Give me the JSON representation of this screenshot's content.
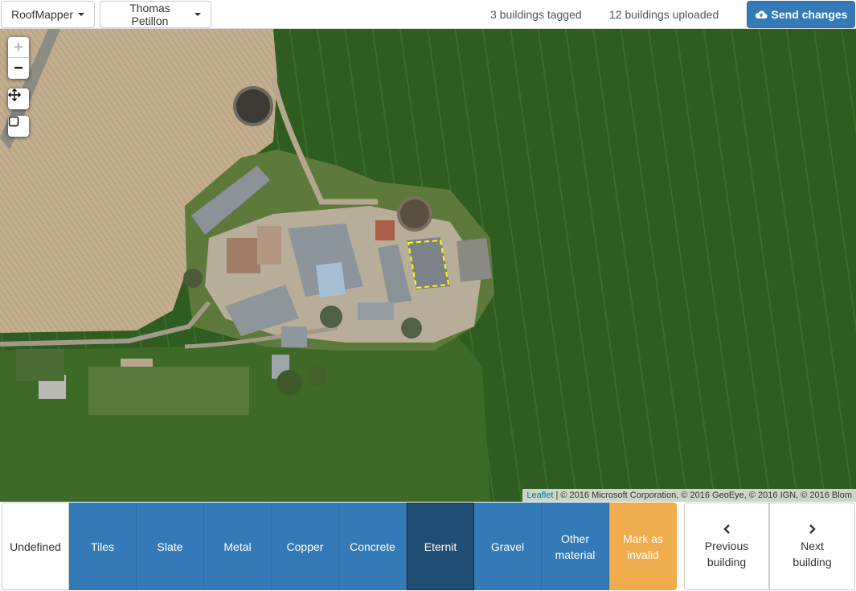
{
  "navbar": {
    "project_menu": "RoofMapper",
    "user_menu": "Thomas Petillon",
    "tagged_count": "3 buildings tagged",
    "uploaded_count": "12 buildings uploaded",
    "send_label": "Send changes"
  },
  "map": {
    "zoom_in": "+",
    "zoom_out": "−",
    "attribution_link": "Leaflet",
    "attribution_text": " | © 2016 Microsoft Corporation, © 2016 GeoEye, © 2016 IGN, © 2016 Blom"
  },
  "materials": {
    "undefined": "Undefined",
    "tiles": "Tiles",
    "slate": "Slate",
    "metal": "Metal",
    "copper": "Copper",
    "concrete": "Concrete",
    "eternit": "Eternit",
    "gravel": "Gravel",
    "other_line1": "Other",
    "other_line2": "material",
    "invalid_line1": "Mark as",
    "invalid_line2": "invalid"
  },
  "navigation": {
    "previous_line1": "Previous",
    "previous_line2": "building",
    "next_line1": "Next",
    "next_line2": "building"
  },
  "colors": {
    "primary": "#337ab7",
    "active": "#204d74",
    "warning": "#f0ad4e",
    "highlight": "#ffff00"
  },
  "icons": {
    "send": "cloud-upload-icon",
    "move": "move-arrows-icon",
    "draw": "square-icon",
    "previous": "chevron-left-icon",
    "next": "chevron-right-icon"
  },
  "selected_material": "eternit"
}
